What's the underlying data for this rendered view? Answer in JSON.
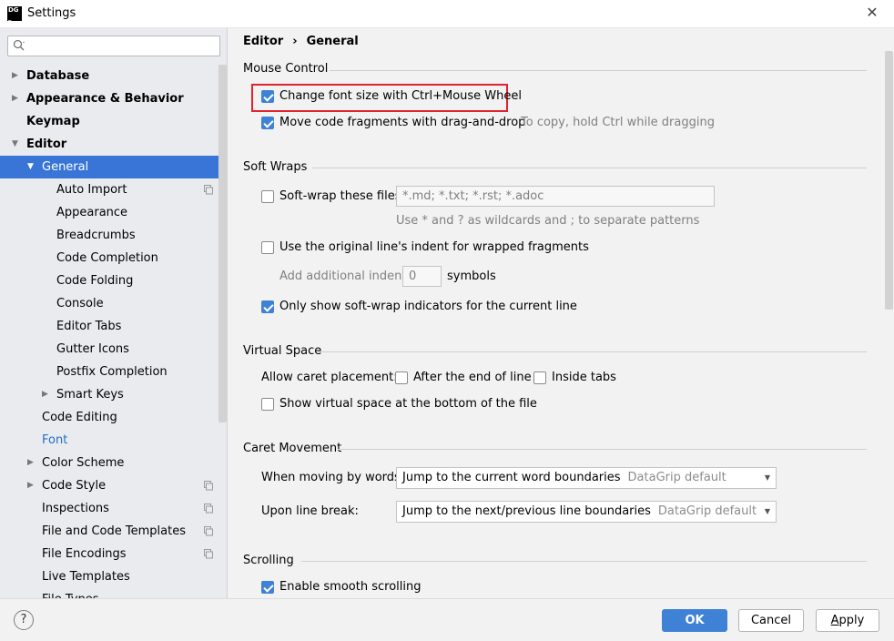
{
  "window": {
    "title": "Settings",
    "logo_top": "DG",
    "logo_bottom": "_"
  },
  "search": {
    "placeholder": ""
  },
  "sidebar": {
    "items": [
      {
        "label": "Database",
        "level": 0,
        "arrow": "right",
        "bold": true
      },
      {
        "label": "Appearance & Behavior",
        "level": 0,
        "arrow": "right",
        "bold": true
      },
      {
        "label": "Keymap",
        "level": 0,
        "arrow": "",
        "bold": true
      },
      {
        "label": "Editor",
        "level": 0,
        "arrow": "down",
        "bold": true
      },
      {
        "label": "General",
        "level": 1,
        "arrow": "down",
        "selected": true
      },
      {
        "label": "Auto Import",
        "level": 2,
        "copy": true
      },
      {
        "label": "Appearance",
        "level": 2
      },
      {
        "label": "Breadcrumbs",
        "level": 2
      },
      {
        "label": "Code Completion",
        "level": 2
      },
      {
        "label": "Code Folding",
        "level": 2
      },
      {
        "label": "Console",
        "level": 2
      },
      {
        "label": "Editor Tabs",
        "level": 2
      },
      {
        "label": "Gutter Icons",
        "level": 2
      },
      {
        "label": "Postfix Completion",
        "level": 2
      },
      {
        "label": "Smart Keys",
        "level": 2,
        "arrow": "right"
      },
      {
        "label": "Code Editing",
        "level": 1
      },
      {
        "label": "Font",
        "level": 1,
        "link": true
      },
      {
        "label": "Color Scheme",
        "level": 1,
        "arrow": "right"
      },
      {
        "label": "Code Style",
        "level": 1,
        "arrow": "right",
        "copy": true
      },
      {
        "label": "Inspections",
        "level": 1,
        "copy": true
      },
      {
        "label": "File and Code Templates",
        "level": 1,
        "copy": true
      },
      {
        "label": "File Encodings",
        "level": 1,
        "copy": true
      },
      {
        "label": "Live Templates",
        "level": 1
      },
      {
        "label": "File Types",
        "level": 1
      }
    ]
  },
  "breadcrumb": {
    "parent": "Editor",
    "separator": "›",
    "current": "General"
  },
  "mouse_control": {
    "title": "Mouse Control",
    "change_font": {
      "label": "Change font size with Ctrl+Mouse Wheel",
      "checked": true
    },
    "drag_drop": {
      "label": "Move code fragments with drag-and-drop",
      "checked": true,
      "hint": "To copy, hold Ctrl while dragging"
    }
  },
  "soft_wraps": {
    "title": "Soft Wraps",
    "wrap_files": {
      "label": "Soft-wrap these files:",
      "checked": false,
      "value": "*.md; *.txt; *.rst; *.adoc",
      "hint": "Use * and ? as wildcards and ; to separate patterns"
    },
    "original_indent": {
      "label": "Use the original line's indent for wrapped fragments",
      "checked": false
    },
    "additional_indent": {
      "label": "Add additional indent:",
      "value": "0",
      "unit": "symbols"
    },
    "indicators": {
      "label": "Only show soft-wrap indicators for the current line",
      "checked": true
    }
  },
  "virtual_space": {
    "title": "Virtual Space",
    "caret_label": "Allow caret placement:",
    "after_end": {
      "label": "After the end of line",
      "checked": false
    },
    "inside_tabs": {
      "label": "Inside tabs",
      "checked": false
    },
    "show_bottom": {
      "label": "Show virtual space at the bottom of the file",
      "checked": false
    }
  },
  "caret_movement": {
    "title": "Caret Movement",
    "by_words": {
      "label": "When moving by words:",
      "value": "Jump to the current word boundaries",
      "sub": "DataGrip default"
    },
    "line_break": {
      "label": "Upon line break:",
      "value": "Jump to the next/previous line boundaries",
      "sub": "DataGrip default"
    }
  },
  "scrolling": {
    "title": "Scrolling",
    "smooth": {
      "label": "Enable smooth scrolling",
      "checked": true
    }
  },
  "footer": {
    "help": "?",
    "ok": "OK",
    "cancel": "Cancel",
    "apply_u": "A",
    "apply_rest": "pply"
  },
  "colors": {
    "accent": "#3f81d5",
    "selection": "#3875d7",
    "highlight": "#e0242e",
    "link": "#2470c2"
  }
}
